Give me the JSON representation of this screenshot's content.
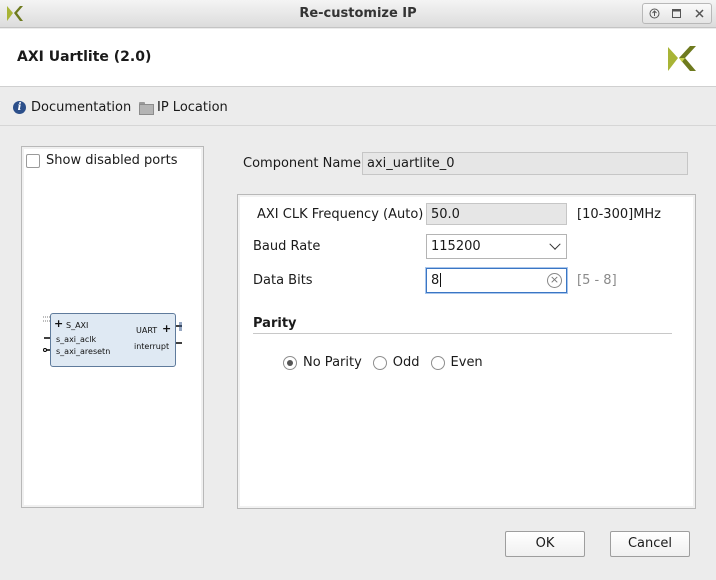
{
  "window": {
    "title": "Re-customize IP",
    "logo_icon": "xilinx-logo-icon",
    "controls": [
      "restore-up-icon",
      "maximize-icon",
      "close-icon"
    ]
  },
  "header": {
    "ip_title": "AXI Uartlite (2.0)",
    "brand_icon": "xilinx-logo-icon"
  },
  "links": {
    "documentation": "Documentation",
    "ip_location": "IP Location"
  },
  "left_panel": {
    "show_disabled_ports": "Show disabled ports",
    "show_disabled_ports_checked": false,
    "symbol": {
      "left_ports": [
        "S_AXI",
        "s_axi_aclk",
        "s_axi_aresetn"
      ],
      "right_ports": [
        "UART",
        "interrupt"
      ]
    }
  },
  "component": {
    "label": "Component Name",
    "value": "axi_uartlite_0"
  },
  "params": {
    "clk_freq": {
      "label": "AXI CLK Frequency (Auto)",
      "value": "50.0",
      "range": "[10-300]MHz"
    },
    "baud_rate": {
      "label": "Baud Rate",
      "value": "115200"
    },
    "data_bits": {
      "label": "Data Bits",
      "value": "8",
      "range": "[5 - 8]"
    },
    "parity": {
      "title": "Parity",
      "options": [
        "No Parity",
        "Odd",
        "Even"
      ],
      "selected": "No Parity"
    }
  },
  "buttons": {
    "ok": "OK",
    "cancel": "Cancel"
  },
  "colors": {
    "accent": "#3a76c4",
    "logo": "#8a9a2a",
    "symbol_fill": "#dfe9f3"
  }
}
